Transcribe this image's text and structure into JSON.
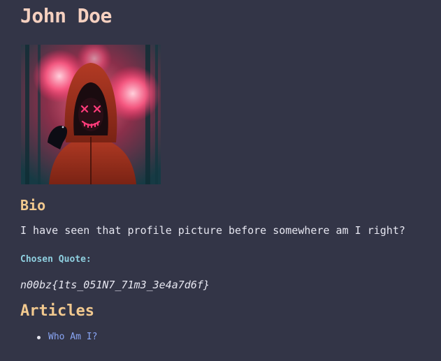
{
  "profile": {
    "name": "John Doe"
  },
  "bio": {
    "heading": "Bio",
    "text": "I have seen that profile picture before somewhere am I right?"
  },
  "quote": {
    "label": "Chosen Quote:",
    "text": "n00bz{1ts_051N7_71m3_3e4a7d6f}"
  },
  "articles": {
    "heading": "Articles",
    "items": [
      {
        "label": "Who Am I?"
      }
    ]
  },
  "colors": {
    "background": "#333547",
    "name": "#f5d0c0",
    "heading": "#f2c98f",
    "quote_label": "#8ecfdf",
    "link": "#8aa6f5",
    "text": "#e6e6f0"
  }
}
